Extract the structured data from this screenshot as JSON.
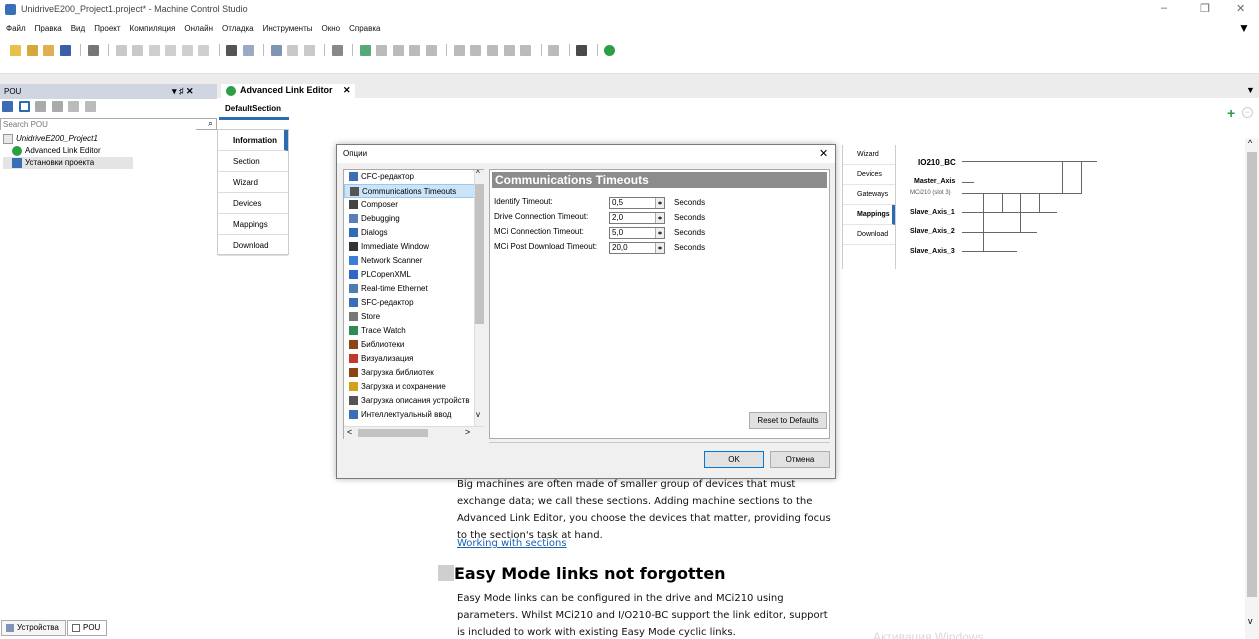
{
  "window": {
    "title": "UnidriveE200_Project1.project* - Machine Control Studio",
    "min": "–",
    "max": "❐",
    "close": "✕",
    "overflow": "▼"
  },
  "menu": [
    "Файл",
    "Правка",
    "Вид",
    "Проект",
    "Компиляция",
    "Онлайн",
    "Отладка",
    "Инструменты",
    "Окно",
    "Справка"
  ],
  "pou_pane": {
    "title": "POU",
    "ctrl": "▾ ♯ ✕",
    "search_placeholder": "Search POU",
    "tree": {
      "root": "UnidriveE200_Project1",
      "items": [
        "Advanced Link Editor",
        "Установки проекта"
      ]
    },
    "bottom_tabs": [
      "Устройства",
      "POU"
    ]
  },
  "editor": {
    "tab_label": "Advanced Link Editor",
    "tab_close": "✕",
    "default_section": "DefaultSection",
    "section_nav": [
      "Information",
      "Section",
      "Wizard",
      "Devices",
      "Mappings",
      "Download"
    ],
    "mini_nav": [
      "Wizard",
      "Devices",
      "Gateways",
      "Mappings",
      "Download"
    ],
    "diagram": {
      "nodes": [
        "IO210_BC",
        "Master_Axis",
        "MCi210 (slot 3)",
        "Slave_Axis_1",
        "Slave_Axis_2",
        "Slave_Axis_3"
      ]
    },
    "paragraph1": "Big machines are often made of smaller group of devices that must exchange data; we call these sections. Adding machine sections to the Advanced Link Editor, you choose the devices that matter, providing focus to the section's task at hand.",
    "link1": "Working with sections",
    "heading2": "Easy Mode links not forgotten",
    "paragraph2": "Easy Mode links can be configured in the drive and MCi210 using parameters. Whilst MCi210 and I/O210-BC support the link editor, support is included to work with existing Easy Mode cyclic links.",
    "watermark": "Активация Windows",
    "add": "+",
    "remove": "−"
  },
  "dialog": {
    "title": "Опции",
    "close": "✕",
    "categories": [
      {
        "label": "CFC-редактор",
        "icon": "cfc-icon",
        "color": "#3a6fb5"
      },
      {
        "label": "Communications Timeouts",
        "icon": "clock-icon",
        "color": "#555555"
      },
      {
        "label": "Composer",
        "icon": "composer-icon",
        "color": "#444444"
      },
      {
        "label": "Debugging",
        "icon": "debug-icon",
        "color": "#5a7fb8"
      },
      {
        "label": "Dialogs",
        "icon": "dialog-icon",
        "color": "#2d6db5"
      },
      {
        "label": "Immediate Window",
        "icon": "window-icon",
        "color": "#333333"
      },
      {
        "label": "Network Scanner",
        "icon": "search-icon",
        "color": "#3b7dd8"
      },
      {
        "label": "PLCopenXML",
        "icon": "xml-icon",
        "color": "#2f66c8"
      },
      {
        "label": "Real-time Ethernet",
        "icon": "ethernet-icon",
        "color": "#4a7fb0"
      },
      {
        "label": "SFC-редактор",
        "icon": "sfc-icon",
        "color": "#3a6fb5"
      },
      {
        "label": "Store",
        "icon": "store-icon",
        "color": "#777777"
      },
      {
        "label": "Trace Watch",
        "icon": "trace-icon",
        "color": "#2e8b57"
      },
      {
        "label": "Библиотеки",
        "icon": "library-icon",
        "color": "#8b4513"
      },
      {
        "label": "Визуализация",
        "icon": "visualization-icon",
        "color": "#c0392b"
      },
      {
        "label": "Загрузка библиотек",
        "icon": "library-download-icon",
        "color": "#8b4513"
      },
      {
        "label": "Загрузка и сохранение",
        "icon": "folder-icon",
        "color": "#d4a017"
      },
      {
        "label": "Загрузка описания устройств",
        "icon": "device-description-icon",
        "color": "#555555"
      },
      {
        "label": "Интеллектуальный ввод",
        "icon": "smart-input-icon",
        "color": "#3a6fb5"
      }
    ],
    "panel_title": "Communications Timeouts",
    "fields": [
      {
        "label": "Identify Timeout:",
        "value": "0,5",
        "unit": "Seconds"
      },
      {
        "label": "Drive Connection Timeout:",
        "value": "2,0",
        "unit": "Seconds"
      },
      {
        "label": "MCi Connection Timeout:",
        "value": "5,0",
        "unit": "Seconds"
      },
      {
        "label": "MCi Post Download Timeout:",
        "value": "20,0",
        "unit": "Seconds"
      }
    ],
    "reset_label": "Reset to Defaults",
    "ok_label": "OK",
    "cancel_label": "Отмена",
    "scroll_up": "^",
    "scroll_down": "v",
    "scroll_left": "<",
    "scroll_right": ">"
  },
  "colors": {
    "accent": "#2b6cb0",
    "selection": "#cce4f7",
    "panel_header": "#8c8c8c"
  }
}
